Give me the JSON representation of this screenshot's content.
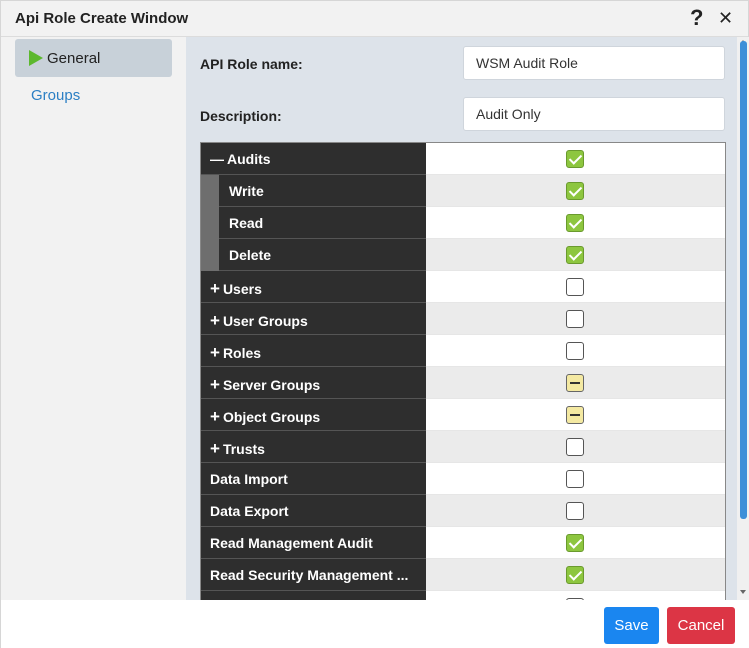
{
  "window": {
    "title": "Api Role Create Window"
  },
  "sidebar": {
    "items": [
      {
        "label": "General"
      },
      {
        "label": "Groups"
      }
    ]
  },
  "form": {
    "role_name_label": "API Role name:",
    "role_name_value": "WSM Audit Role",
    "description_label": "Description:",
    "description_value": "Audit Only"
  },
  "permissions": [
    {
      "label": "Audits",
      "prefix": "—",
      "state": "checked",
      "child": false
    },
    {
      "label": "Write",
      "prefix": "",
      "state": "checked",
      "child": true
    },
    {
      "label": "Read",
      "prefix": "",
      "state": "checked",
      "child": true
    },
    {
      "label": "Delete",
      "prefix": "",
      "state": "checked",
      "child": true
    },
    {
      "label": "Users",
      "prefix": "+",
      "state": "unchecked",
      "child": false
    },
    {
      "label": "User Groups",
      "prefix": "+",
      "state": "unchecked",
      "child": false
    },
    {
      "label": "Roles",
      "prefix": "+",
      "state": "unchecked",
      "child": false
    },
    {
      "label": "Server Groups",
      "prefix": "+",
      "state": "partial",
      "child": false
    },
    {
      "label": "Object Groups",
      "prefix": "+",
      "state": "partial",
      "child": false
    },
    {
      "label": "Trusts",
      "prefix": "+",
      "state": "unchecked",
      "child": false
    },
    {
      "label": "Data Import",
      "prefix": "",
      "state": "unchecked",
      "child": false
    },
    {
      "label": "Data Export",
      "prefix": "",
      "state": "unchecked",
      "child": false
    },
    {
      "label": "Read Management Audit",
      "prefix": "",
      "state": "checked",
      "child": false
    },
    {
      "label": "Read Security Management ...",
      "prefix": "",
      "state": "checked",
      "child": false
    },
    {
      "label": "",
      "prefix": "",
      "state": "unchecked",
      "child": false
    }
  ],
  "footer": {
    "save_label": "Save",
    "cancel_label": "Cancel"
  },
  "colors": {
    "accent_blue": "#1a86f0",
    "cancel_red": "#dc3545",
    "checked_green": "#8dc63f",
    "partial_yellow": "#f4e9a2"
  }
}
